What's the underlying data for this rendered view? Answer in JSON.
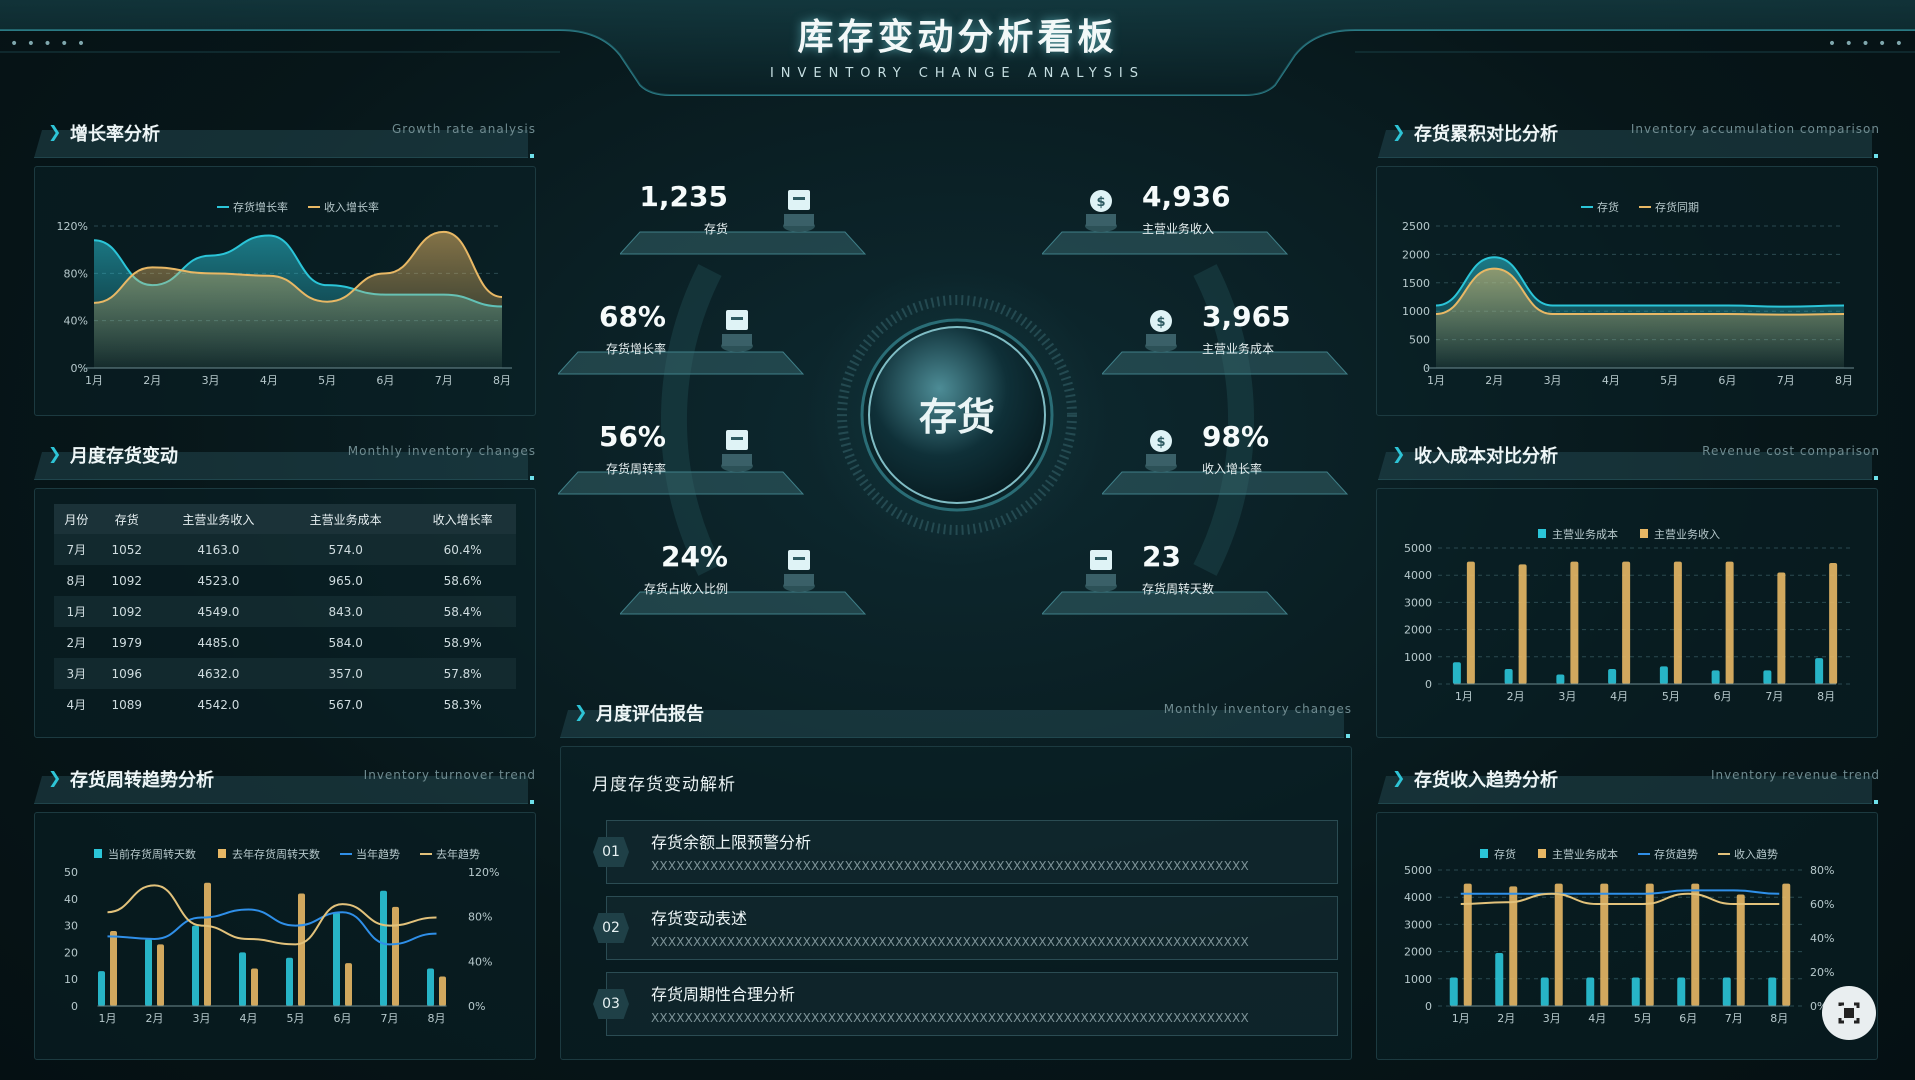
{
  "header": {
    "title": "库存变动分析看板",
    "subtitle": "INVENTORY CHANGE ANALYSIS",
    "dots": "• • • • •"
  },
  "panels": {
    "growth": {
      "title": "增长率分析",
      "en": "Growth rate analysis"
    },
    "monthly": {
      "title": "月度存货变动",
      "en": "Monthly inventory changes"
    },
    "turnover": {
      "title": "存货周转趋势分析",
      "en": "Inventory turnover trend"
    },
    "accum": {
      "title": "存货累积对比分析",
      "en": "Inventory accumulation comparison"
    },
    "revcost": {
      "title": "收入成本对比分析",
      "en": "Revenue cost comparison"
    },
    "invrev": {
      "title": "存货收入趋势分析",
      "en": "Inventory revenue trend"
    },
    "report": {
      "title": "月度评估报告",
      "en": "Monthly inventory changes"
    }
  },
  "table": {
    "headers": [
      "月份",
      "存货",
      "主营业务收入",
      "主营业务成本",
      "收入增长率"
    ],
    "rows": [
      [
        "7月",
        "1052",
        "4163.0",
        "574.0",
        "60.4%"
      ],
      [
        "8月",
        "1092",
        "4523.0",
        "965.0",
        "58.6%"
      ],
      [
        "1月",
        "1092",
        "4549.0",
        "843.0",
        "58.4%"
      ],
      [
        "2月",
        "1979",
        "4485.0",
        "584.0",
        "58.9%"
      ],
      [
        "3月",
        "1096",
        "4632.0",
        "357.0",
        "57.8%"
      ],
      [
        "4月",
        "1089",
        "4542.0",
        "567.0",
        "58.3%"
      ]
    ]
  },
  "center": {
    "title": "存货"
  },
  "kpis": [
    {
      "value": "1,235",
      "label": "存货",
      "icon": "box-icon"
    },
    {
      "value": "68%",
      "label": "存货增长率",
      "icon": "box-icon"
    },
    {
      "value": "56%",
      "label": "存货周转率",
      "icon": "box-icon"
    },
    {
      "value": "24%",
      "label": "存货占收入比例",
      "icon": "box-icon"
    },
    {
      "value": "4,936",
      "label": "主营业务收入",
      "icon": "money-bag-icon"
    },
    {
      "value": "3,965",
      "label": "主营业务成本",
      "icon": "money-bag-icon"
    },
    {
      "value": "98%",
      "label": "收入增长率",
      "icon": "money-bag-icon"
    },
    {
      "value": "23",
      "label": "存货周转天数",
      "icon": "box-icon"
    }
  ],
  "report": {
    "heading": "月度存货变动解析",
    "items": [
      {
        "num": "01",
        "title": "存货余额上限预警分析",
        "text": "XXXXXXXXXXXXXXXXXXXXXXXXXXXXXXXXXXXXXXXXXXXXXXXXXXXXXXXXXXXXXXXXXXXXXXX"
      },
      {
        "num": "02",
        "title": "存货变动表述",
        "text": "XXXXXXXXXXXXXXXXXXXXXXXXXXXXXXXXXXXXXXXXXXXXXXXXXXXXXXXXXXXXXXXXXXXXXXX"
      },
      {
        "num": "03",
        "title": "存货周期性合理分析",
        "text": "XXXXXXXXXXXXXXXXXXXXXXXXXXXXXXXXXXXXXXXXXXXXXXXXXXXXXXXXXXXXXXXXXXXXXXX"
      }
    ]
  },
  "colors": {
    "cyan": "#2bc5d8",
    "gold": "#e8b865",
    "blue": "#2f8fe8"
  },
  "chart_data": [
    {
      "id": "growth",
      "type": "area",
      "categories": [
        "1月",
        "2月",
        "3月",
        "4月",
        "5月",
        "6月",
        "7月",
        "8月"
      ],
      "series": [
        {
          "name": "存货增长率",
          "values": [
            108,
            70,
            95,
            112,
            70,
            62,
            62,
            52
          ]
        },
        {
          "name": "收入增长率",
          "values": [
            55,
            85,
            80,
            78,
            56,
            80,
            115,
            60
          ]
        }
      ],
      "yticks": [
        "0%",
        "40%",
        "80%",
        "120%"
      ],
      "ylim": [
        0,
        120
      ]
    },
    {
      "id": "accum",
      "type": "area",
      "categories": [
        "1月",
        "2月",
        "3月",
        "4月",
        "5月",
        "6月",
        "7月",
        "8月"
      ],
      "series": [
        {
          "name": "存货",
          "values": [
            1100,
            1950,
            1100,
            1100,
            1100,
            1100,
            1080,
            1100
          ]
        },
        {
          "name": "存货同期",
          "values": [
            950,
            1750,
            950,
            950,
            950,
            950,
            940,
            950
          ]
        }
      ],
      "yticks": [
        "0",
        "500",
        "1000",
        "1500",
        "2000",
        "2500"
      ],
      "ylim": [
        0,
        2500
      ]
    },
    {
      "id": "turnover",
      "type": "bar",
      "categories": [
        "1月",
        "2月",
        "3月",
        "4月",
        "5月",
        "6月",
        "7月",
        "8月"
      ],
      "series": [
        {
          "name": "当前存货周转天数",
          "values": [
            13,
            25,
            30,
            20,
            18,
            35,
            43,
            14
          ]
        },
        {
          "name": "去年存货周转天数",
          "values": [
            28,
            23,
            46,
            14,
            42,
            16,
            37,
            11
          ]
        },
        {
          "name": "当年趋势",
          "values": [
            26,
            25,
            33,
            36,
            30,
            35,
            23,
            27
          ]
        },
        {
          "name": "去年趋势",
          "values": [
            35,
            45,
            30,
            25,
            23,
            38,
            30,
            33
          ]
        }
      ],
      "yticks": [
        "0",
        "10",
        "20",
        "30",
        "40",
        "50"
      ],
      "y2ticks": [
        "0%",
        "40%",
        "80%",
        "120%"
      ],
      "ylim": [
        0,
        50
      ]
    },
    {
      "id": "revcost",
      "type": "bar",
      "categories": [
        "1月",
        "2月",
        "3月",
        "4月",
        "5月",
        "6月",
        "7月",
        "8月"
      ],
      "series": [
        {
          "name": "主营业务成本",
          "values": [
            800,
            550,
            350,
            550,
            650,
            500,
            500,
            950
          ]
        },
        {
          "name": "主营业务收入",
          "values": [
            4500,
            4400,
            4500,
            4500,
            4500,
            4500,
            4100,
            4450
          ]
        }
      ],
      "yticks": [
        "0",
        "1000",
        "2000",
        "3000",
        "4000",
        "5000"
      ],
      "ylim": [
        0,
        5000
      ]
    },
    {
      "id": "invrev",
      "type": "bar",
      "categories": [
        "1月",
        "2月",
        "3月",
        "4月",
        "5月",
        "6月",
        "7月",
        "8月"
      ],
      "series": [
        {
          "name": "存货",
          "values": [
            1050,
            1950,
            1050,
            1050,
            1050,
            1050,
            1050,
            1050
          ]
        },
        {
          "name": "主营业务成本",
          "values": [
            4500,
            4400,
            4500,
            4500,
            4500,
            4500,
            4100,
            4500
          ]
        },
        {
          "name": "存货趋势",
          "values": [
            66,
            66,
            66,
            66,
            66,
            68,
            68,
            66
          ]
        },
        {
          "name": "收入趋势",
          "values": [
            60,
            61,
            66,
            60,
            60,
            66,
            60,
            60
          ]
        }
      ],
      "yticks": [
        "0",
        "1000",
        "2000",
        "3000",
        "4000",
        "5000"
      ],
      "y2ticks": [
        "0%",
        "20%",
        "40%",
        "60%",
        "80%"
      ],
      "ylim": [
        0,
        5000
      ]
    }
  ]
}
